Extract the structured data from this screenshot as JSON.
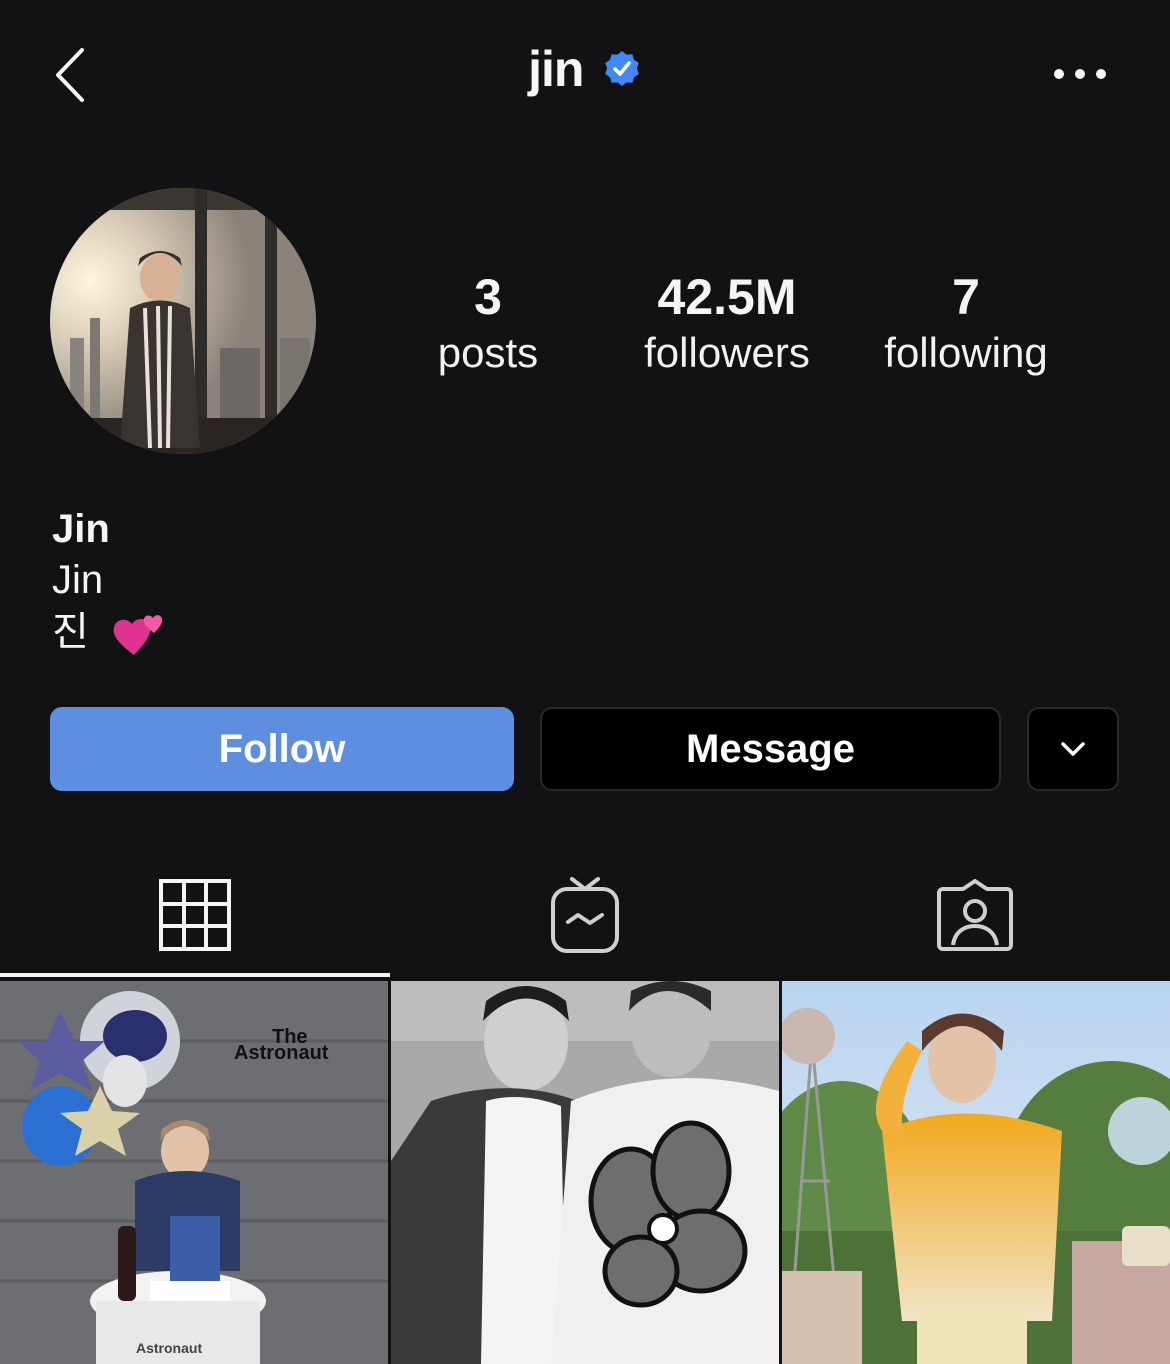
{
  "header": {
    "username": "jin",
    "back_icon": "chevron-left-icon",
    "verified_icon": "verified-badge-icon",
    "more_icon": "more-horizontal-icon",
    "verified_color": "#3f88f6"
  },
  "profile": {
    "stats": [
      {
        "number": "3",
        "label": "posts"
      },
      {
        "number": "42.5M",
        "label": "followers"
      },
      {
        "number": "7",
        "label": "following"
      }
    ],
    "bio": {
      "name": "Jin",
      "line1": "Jin",
      "line2": "진",
      "emoji": "💕"
    }
  },
  "actions": {
    "follow_label": "Follow",
    "message_label": "Message",
    "dropdown_icon": "chevron-down-icon",
    "follow_color": "#5e8ee0"
  },
  "tabs": [
    {
      "icon": "grid-icon",
      "active": true
    },
    {
      "icon": "igtv-icon",
      "active": false
    },
    {
      "icon": "tagged-person-icon",
      "active": false
    }
  ],
  "posts": [
    {
      "overlay_text_1": "The",
      "overlay_text_2": "Astronaut",
      "overlay_text_3": "Astronaut"
    },
    {},
    {}
  ]
}
